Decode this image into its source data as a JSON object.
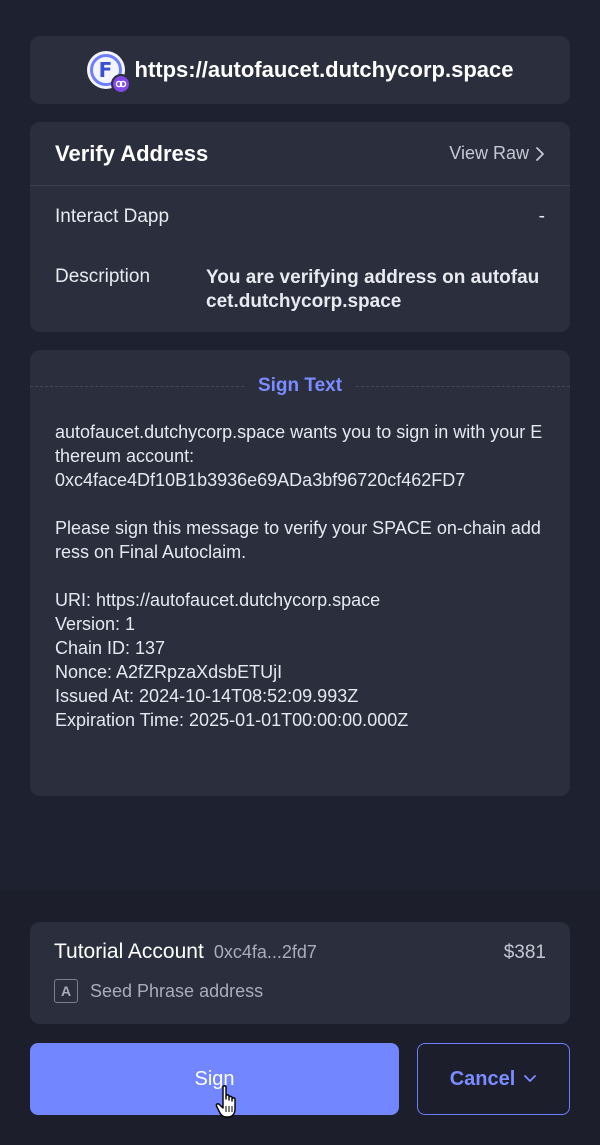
{
  "site": {
    "logo_letter": "F",
    "url": "https://autofaucet.dutchycorp.space"
  },
  "verify": {
    "title": "Verify Address",
    "view_raw": "View Raw",
    "dapp_label": "Interact Dapp",
    "dapp_value": "-",
    "desc_label": "Description",
    "desc_value": "You are verifying address on autofaucet.dutchycorp.space"
  },
  "sign": {
    "title": "Sign Text",
    "message": "autofaucet.dutchycorp.space wants you to sign in with your Ethereum account:\n0xc4face4Df10B1b3936e69ADa3bf96720cf462FD7\n\nPlease sign this message to verify your SPACE on-chain address on Final Autoclaim.\n\nURI: https://autofaucet.dutchycorp.space\nVersion: 1\nChain ID: 137\nNonce: A2fZRpzaXdsbETUjI\nIssued At: 2024-10-14T08:52:09.993Z\nExpiration Time: 2025-01-01T00:00:00.000Z"
  },
  "account": {
    "name": "Tutorial Account",
    "address": "0xc4fa...2fd7",
    "balance": "$381",
    "type_badge": "A",
    "type_label": "Seed Phrase address"
  },
  "actions": {
    "sign_label": "Sign",
    "cancel_label": "Cancel"
  },
  "colors": {
    "accent": "#7186ff",
    "background": "#1e2130",
    "card": "#2b2e3d",
    "polygon": "#8247e5"
  }
}
